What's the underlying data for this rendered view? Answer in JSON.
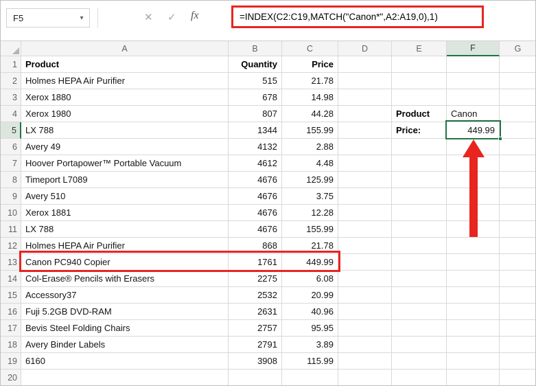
{
  "colors": {
    "annotation_red": "#e8251f",
    "selection_green": "#217346",
    "gridline": "#d9d9d9",
    "header_bg": "#f4f4f4",
    "selected_header_bg": "#dde5df"
  },
  "icons": {
    "name_box_dropdown": "▾",
    "cancel": "✕",
    "enter": "✓",
    "fx": "fx"
  },
  "formula_bar": {
    "name_box_value": "F5",
    "formula": "=INDEX(C2:C19,MATCH(\"Canon*\",A2:A19,0),1)"
  },
  "grid": {
    "column_letters": [
      "A",
      "B",
      "C",
      "D",
      "E",
      "F",
      "G"
    ],
    "row_numbers": [
      1,
      2,
      3,
      4,
      5,
      6,
      7,
      8,
      9,
      10,
      11,
      12,
      13,
      14,
      15,
      16,
      17,
      18,
      19,
      20
    ],
    "selected_column": "F",
    "selected_row_number": 5,
    "active_cell": "F5",
    "table": {
      "headers": {
        "product": "Product",
        "quantity": "Quantity",
        "price": "Price"
      },
      "rows": [
        {
          "product": "Holmes HEPA Air Purifier",
          "quantity": "515",
          "price": "21.78"
        },
        {
          "product": "Xerox 1880",
          "quantity": "678",
          "price": "14.98"
        },
        {
          "product": "Xerox 1980",
          "quantity": "807",
          "price": "44.28"
        },
        {
          "product": "LX 788",
          "quantity": "1344",
          "price": "155.99"
        },
        {
          "product": "Avery 49",
          "quantity": "4132",
          "price": "2.88"
        },
        {
          "product": "Hoover Portapower™ Portable Vacuum",
          "quantity": "4612",
          "price": "4.48"
        },
        {
          "product": "Timeport L7089",
          "quantity": "4676",
          "price": "125.99"
        },
        {
          "product": "Avery 510",
          "quantity": "4676",
          "price": "3.75"
        },
        {
          "product": "Xerox 1881",
          "quantity": "4676",
          "price": "12.28"
        },
        {
          "product": "LX 788",
          "quantity": "4676",
          "price": "155.99"
        },
        {
          "product": "Holmes HEPA Air Purifier",
          "quantity": "868",
          "price": "21.78"
        },
        {
          "product": "Canon PC940 Copier",
          "quantity": "1761",
          "price": "449.99"
        },
        {
          "product": "Col-Erase® Pencils with Erasers",
          "quantity": "2275",
          "price": "6.08"
        },
        {
          "product": "Accessory37",
          "quantity": "2532",
          "price": "20.99"
        },
        {
          "product": "Fuji 5.2GB DVD-RAM",
          "quantity": "2631",
          "price": "40.96"
        },
        {
          "product": "Bevis Steel Folding Chairs",
          "quantity": "2757",
          "price": "95.95"
        },
        {
          "product": "Avery Binder Labels",
          "quantity": "2791",
          "price": "3.89"
        },
        {
          "product": "6160",
          "quantity": "3908",
          "price": "115.99"
        }
      ]
    },
    "lookup_panel": {
      "product_label": "Product",
      "product_value": "Canon",
      "price_label": "Price:",
      "price_value": "449.99"
    }
  }
}
